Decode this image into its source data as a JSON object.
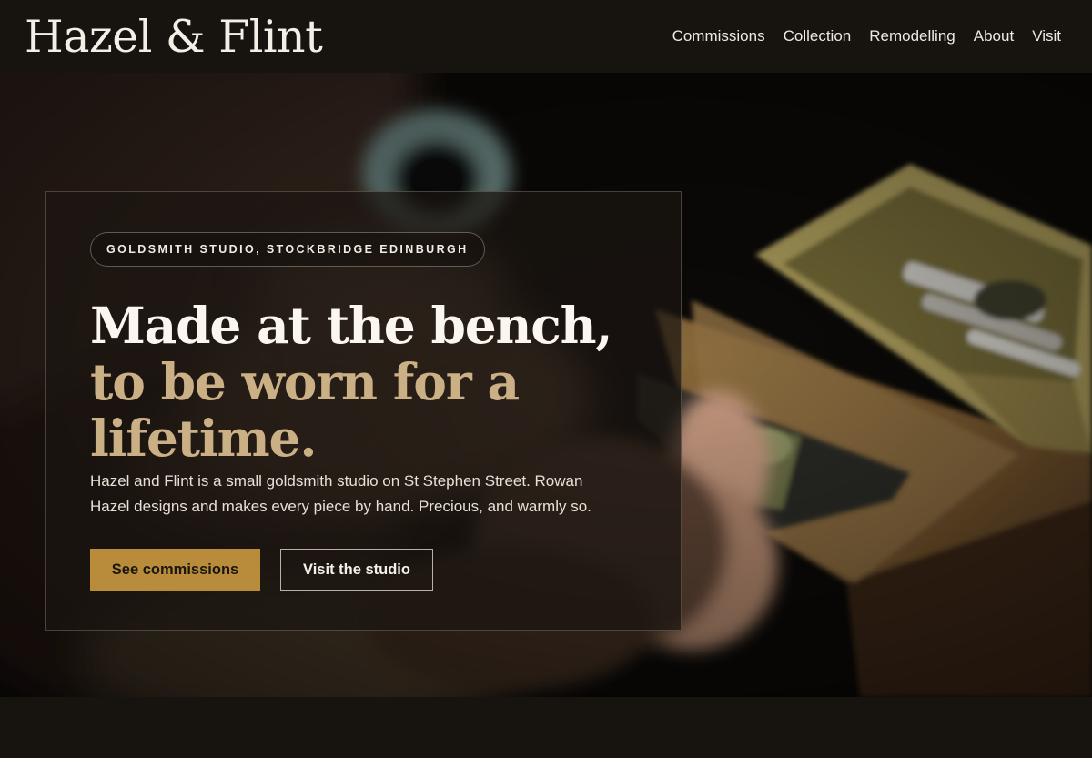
{
  "header": {
    "logo": "Hazel & Flint",
    "nav": [
      {
        "label": "Commissions"
      },
      {
        "label": "Collection"
      },
      {
        "label": "Remodelling"
      },
      {
        "label": "About"
      },
      {
        "label": "Visit"
      }
    ]
  },
  "hero": {
    "eyebrow": "GOLDSMITH STUDIO, STOCKBRIDGE EDINBURGH",
    "headline_line1": "Made at the bench,",
    "headline_line2": "to be worn for a lifetime.",
    "lede": "Hazel and Flint is a small goldsmith studio on St Stephen Street. Rowan Hazel designs and makes every piece by hand. Precious, and warmly so.",
    "primary_cta": "See commissions",
    "secondary_cta": "Visit the studio"
  },
  "colors": {
    "background": "#17130e",
    "accent_gold": "#b88c3a",
    "headline_gold": "#cbb086",
    "text_light": "#fbf7f0"
  }
}
